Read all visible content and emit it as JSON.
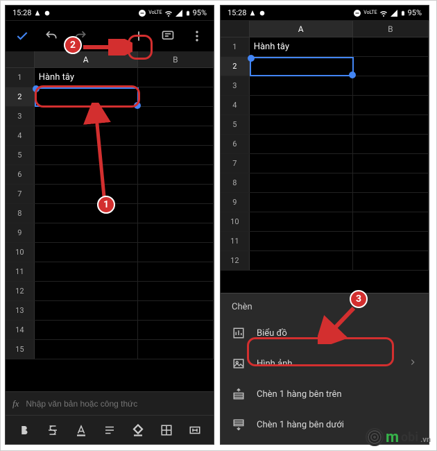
{
  "status": {
    "time": "15:28",
    "battery": "95%"
  },
  "sheet": {
    "columns": [
      "A",
      "B"
    ],
    "row_count_left": 15,
    "row_count_right": 12,
    "a1_value": "Hành tây",
    "selected_cell": "A2"
  },
  "formula_bar": {
    "label": "fx",
    "placeholder": "Nhập văn bản hoặc công thức"
  },
  "insert_menu": {
    "title": "Chèn",
    "items": [
      {
        "icon": "chart-icon",
        "label": "Biểu đồ",
        "chevron": false
      },
      {
        "icon": "image-icon",
        "label": "Hình ảnh",
        "chevron": true
      },
      {
        "icon": "row-above-icon",
        "label": "Chèn 1 hàng bên trên",
        "chevron": false
      },
      {
        "icon": "row-below-icon",
        "label": "Chèn 1 hàng bên dưới",
        "chevron": false
      }
    ]
  },
  "annotations": {
    "marker1": "1",
    "marker2": "2",
    "marker3": "3"
  },
  "watermark": {
    "brand_prefix": "m",
    "brand_rest": "obi",
    "domain": ".vn"
  }
}
